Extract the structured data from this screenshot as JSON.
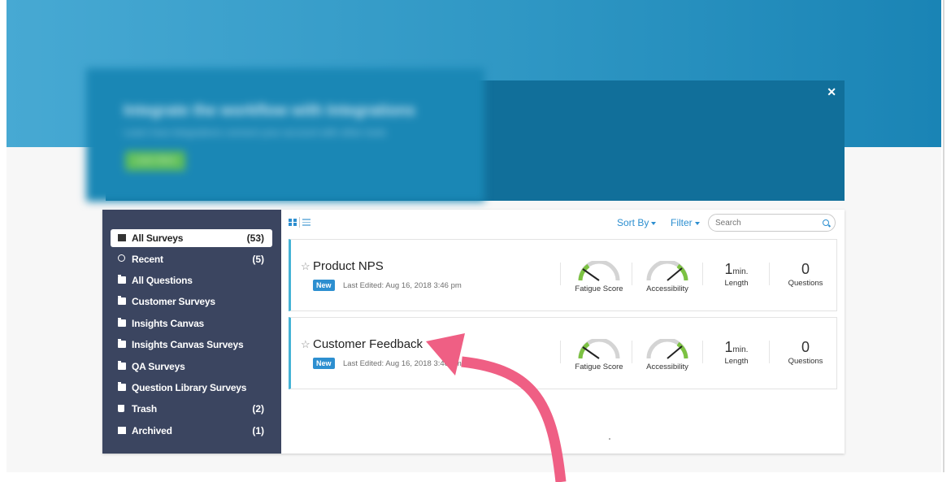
{
  "banner": {
    "blurred_heading": "Integrate the workflow with Integrations",
    "blurred_subtext": "Learn how integrations connect your account with other tools",
    "blurred_button": "Learn More"
  },
  "sidebar": {
    "items": [
      {
        "label": "All Surveys",
        "count": "(53)",
        "icon": "document-icon",
        "active": true
      },
      {
        "label": "Recent",
        "count": "(5)",
        "icon": "clock-icon"
      },
      {
        "label": "All Questions",
        "count": "",
        "icon": "folder-icon"
      },
      {
        "label": "Customer Surveys",
        "count": "",
        "icon": "folder-icon"
      },
      {
        "label": "Insights Canvas",
        "count": "",
        "icon": "folder-icon"
      },
      {
        "label": "Insights Canvas Surveys",
        "count": "",
        "icon": "folder-icon"
      },
      {
        "label": "QA Surveys",
        "count": "",
        "icon": "folder-icon"
      },
      {
        "label": "Question Library Surveys",
        "count": "",
        "icon": "folder-icon"
      },
      {
        "label": "Trash",
        "count": "(2)",
        "icon": "trash-icon"
      },
      {
        "label": "Archived",
        "count": "(1)",
        "icon": "archive-icon"
      }
    ]
  },
  "toolbar": {
    "sort_label": "Sort By",
    "filter_label": "Filter",
    "search_placeholder": "Search"
  },
  "surveys": [
    {
      "title": "Product NPS",
      "badge": "New",
      "edited": "Last Edited: Aug 16, 2018 3:46 pm",
      "fatigue_label": "Fatigue Score",
      "accessibility_label": "Accessibility",
      "length_value": "1",
      "length_unit": "min.",
      "length_label": "Length",
      "questions_value": "0",
      "questions_label": "Questions"
    },
    {
      "title": "Customer Feedback",
      "badge": "New",
      "edited": "Last Edited: Aug 16, 2018 3:46 pm",
      "fatigue_label": "Fatigue Score",
      "accessibility_label": "Accessibility",
      "length_value": "1",
      "length_unit": "min.",
      "length_label": "Length",
      "questions_value": "0",
      "questions_label": "Questions"
    }
  ],
  "colors": {
    "accent": "#2d8fd0",
    "sidebar_bg": "#3b4560",
    "banner_bg": "#116f9a",
    "arrow": "#ef5f84",
    "gauge_green": "#7cc242",
    "survey_border": "#45b3d6"
  }
}
